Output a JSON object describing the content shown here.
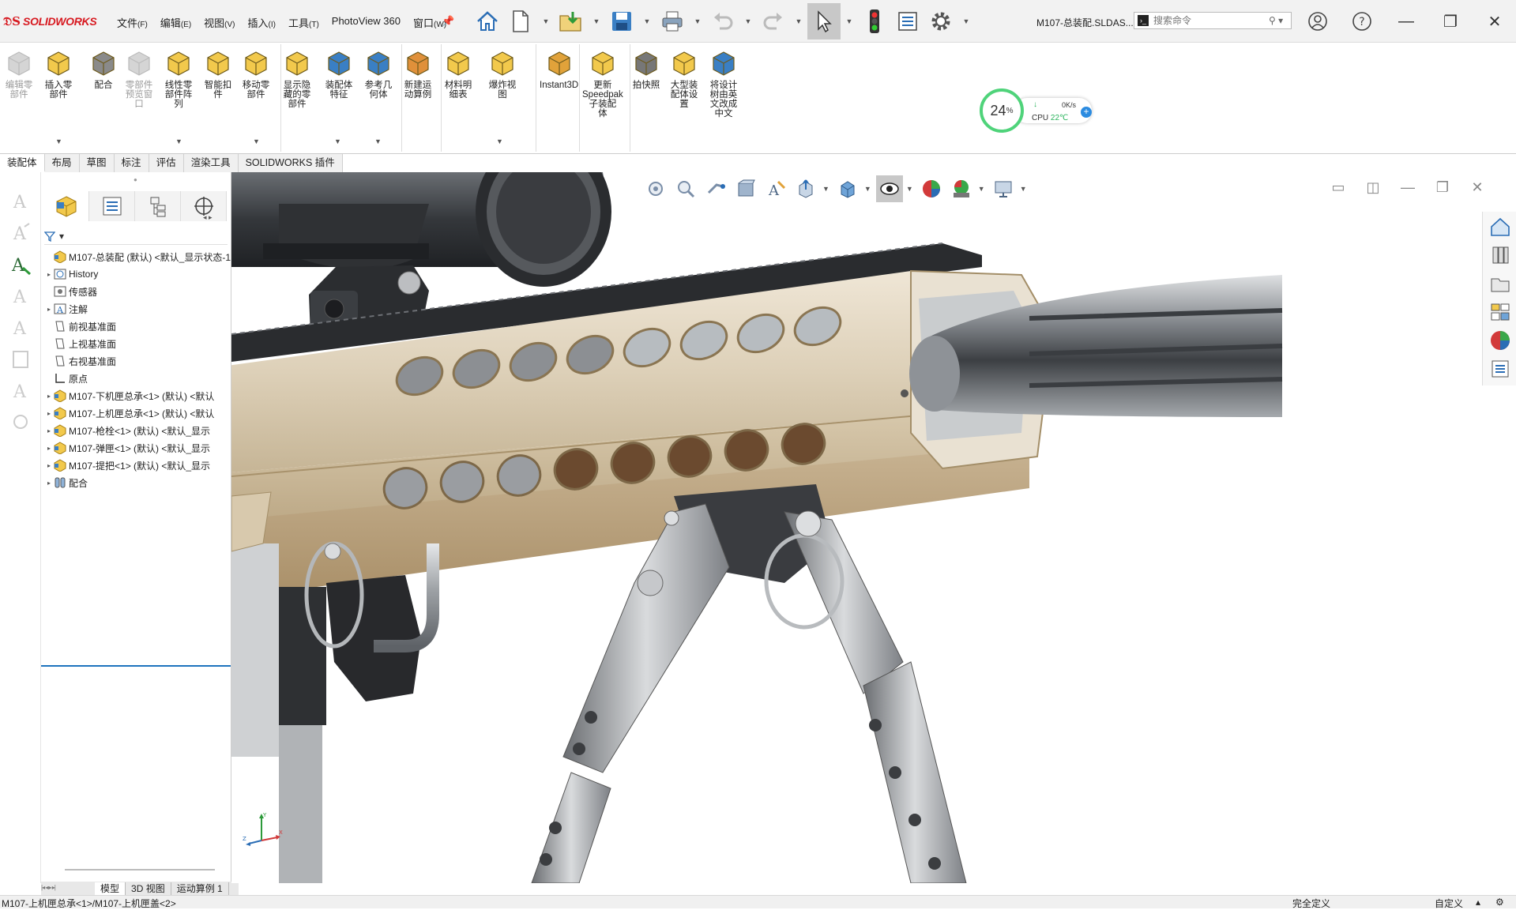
{
  "app": {
    "brand": "SOLIDWORKS",
    "doc_title": "M107-总装配.SLDAS...",
    "menus": [
      {
        "label": "文件",
        "key": "(F)"
      },
      {
        "label": "编辑",
        "key": "(E)"
      },
      {
        "label": "视图",
        "key": "(V)"
      },
      {
        "label": "插入",
        "key": "(I)"
      },
      {
        "label": "工具",
        "key": "(T)"
      },
      {
        "label": "PhotoView 360",
        "key": ""
      },
      {
        "label": "窗口",
        "key": "(W)"
      }
    ],
    "search_placeholder": "搜索命令"
  },
  "commands": [
    {
      "label": "编辑零\n部件",
      "disabled": true
    },
    {
      "label": "插入零\n部件",
      "disabled": false
    },
    {
      "label": "配合",
      "disabled": false
    },
    {
      "label": "零部件\n预览窗\n口",
      "disabled": true
    },
    {
      "label": "线性零\n部件阵\n列",
      "disabled": false
    },
    {
      "label": "智能扣\n件",
      "disabled": false
    },
    {
      "label": "移动零\n部件",
      "disabled": false
    },
    {
      "label": "显示隐\n藏的零\n部件",
      "disabled": false
    },
    {
      "label": "装配体\n特征",
      "disabled": false
    },
    {
      "label": "参考几\n何体",
      "disabled": false
    },
    {
      "label": "新建运\n动算例",
      "disabled": false
    },
    {
      "label": "材料明\n细表",
      "disabled": false
    },
    {
      "label": "爆炸视\n图",
      "disabled": false
    },
    {
      "label": "Instant3D",
      "disabled": false
    },
    {
      "label": "更新\nSpeedpak\n子装配\n体",
      "disabled": false
    },
    {
      "label": "拍快照",
      "disabled": false
    },
    {
      "label": "大型装\n配体设\n置",
      "disabled": false
    },
    {
      "label": "将设计\n树由英\n文改成\n中文",
      "disabled": false
    }
  ],
  "cpu_widget": {
    "percent": "24",
    "percent_sign": "%",
    "net_speed": "0K/s",
    "cpu_label": "CPU",
    "temperature": "22℃"
  },
  "cmd_tabs": [
    "装配体",
    "布局",
    "草图",
    "标注",
    "评估",
    "渲染工具",
    "SOLIDWORKS 插件"
  ],
  "tree": {
    "root": "M107-总装配 (默认) <默认_显示状态-1",
    "items": [
      {
        "label": "History",
        "expandable": true,
        "icon": "history-icon"
      },
      {
        "label": "传感器",
        "expandable": false,
        "icon": "sensor-icon"
      },
      {
        "label": "注解",
        "expandable": true,
        "icon": "annotation-icon"
      },
      {
        "label": "前视基准面",
        "expandable": false,
        "icon": "plane-icon"
      },
      {
        "label": "上视基准面",
        "expandable": false,
        "icon": "plane-icon"
      },
      {
        "label": "右视基准面",
        "expandable": false,
        "icon": "plane-icon"
      },
      {
        "label": "原点",
        "expandable": false,
        "icon": "origin-icon"
      },
      {
        "label": "M107-下机匣总承<1> (默认) <默认",
        "expandable": true,
        "icon": "subassembly-icon"
      },
      {
        "label": "M107-上机匣总承<1> (默认) <默认",
        "expandable": true,
        "icon": "subassembly-icon"
      },
      {
        "label": "M107-枪栓<1> (默认) <默认_显示",
        "expandable": true,
        "icon": "subassembly-icon"
      },
      {
        "label": "M107-弹匣<1> (默认) <默认_显示",
        "expandable": true,
        "icon": "subassembly-icon"
      },
      {
        "label": "M107-提把<1> (默认) <默认_显示",
        "expandable": true,
        "icon": "subassembly-icon"
      },
      {
        "label": "配合",
        "expandable": true,
        "icon": "mates-icon"
      }
    ]
  },
  "bottom_tabs": [
    "模型",
    "3D 视图",
    "运动算例 1"
  ],
  "status": {
    "path": "M107-上机匣总承<1>/M107-上机匣盖<2>",
    "definition": "完全定义",
    "custom": "自定义"
  },
  "colors": {
    "receiver_tan": "#d6c6ac",
    "scope_dark": "#3a3d40",
    "steel": "#b9bcbf",
    "accent_blue": "#1e73be"
  }
}
